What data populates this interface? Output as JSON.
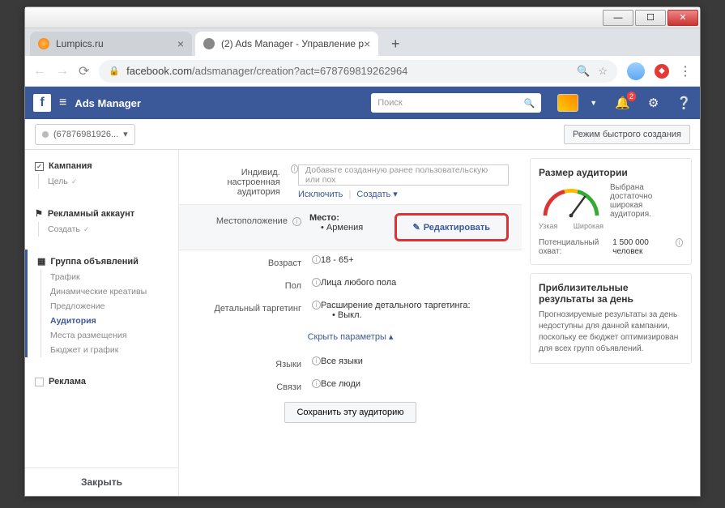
{
  "browser": {
    "tabs": [
      {
        "title": "Lumpics.ru"
      },
      {
        "title": "(2) Ads Manager - Управление р"
      }
    ],
    "url_display": "facebook.com/adsmanager/creation?act=678769819262964",
    "url_host": "facebook.com"
  },
  "fb_header": {
    "title": "Ads Manager",
    "search_placeholder": "Поиск",
    "bell_badge": "2"
  },
  "sub_bar": {
    "account": "(67876981926...",
    "quick_mode": "Режим быстрого создания"
  },
  "left_nav": {
    "campaign": {
      "title": "Кампания",
      "goal": "Цель"
    },
    "ad_account": {
      "title": "Рекламный аккаунт",
      "create": "Создать"
    },
    "adset": {
      "title": "Группа объявлений",
      "items": [
        "Трафик",
        "Динамические креативы",
        "Предложение",
        "Аудитория",
        "Места размещения",
        "Бюджет и график"
      ],
      "active_index": 3
    },
    "ad": {
      "title": "Реклама"
    },
    "close": "Закрыть"
  },
  "form": {
    "custom_audience": {
      "label": "Индивид. настроенная аудитория",
      "placeholder": "Добавьте созданную ранее пользовательскую или пох",
      "exclude": "Исключить",
      "create": "Создать"
    },
    "location": {
      "label": "Местоположение",
      "title": "Место:",
      "value": "Армения",
      "edit": "Редактировать"
    },
    "age": {
      "label": "Возраст",
      "value": "18 - 65+"
    },
    "gender": {
      "label": "Пол",
      "value": "Лица любого пола"
    },
    "detailed": {
      "label": "Детальный таргетинг",
      "title": "Расширение детального таргетинга:",
      "value": "Выкл."
    },
    "hide_params": "Скрыть параметры",
    "languages": {
      "label": "Языки",
      "value": "Все языки"
    },
    "connections": {
      "label": "Связи",
      "value": "Все люди"
    },
    "save_audience": "Сохранить эту аудиторию"
  },
  "right": {
    "size": {
      "title": "Размер аудитории",
      "narrow": "Узкая",
      "wide": "Широкая",
      "desc": "Выбрана достаточно широкая аудитория.",
      "reach_label": "Потенциальный охват:",
      "reach_value": "1 500 000 человек"
    },
    "results": {
      "title": "Приблизительные результаты за день",
      "desc": "Прогнозируемые результаты за день недоступны для данной кампании, поскольку ее бюджет оптимизирован для всех групп объявлений."
    }
  }
}
